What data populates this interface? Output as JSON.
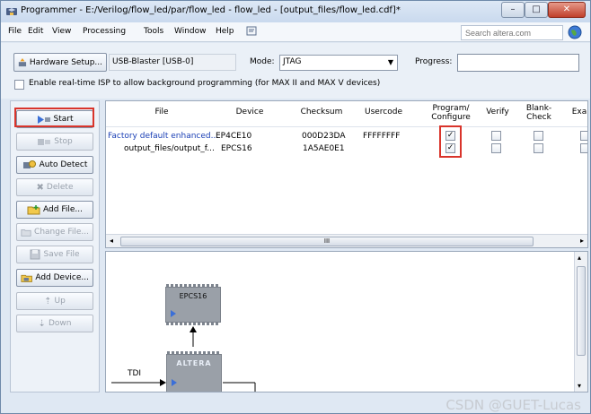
{
  "window": {
    "title": "Programmer - E:/Verilog/flow_led/par/flow_led - flow_led - [output_files/flow_led.cdf]*",
    "controls": {
      "minimize": "–",
      "maximize": "□",
      "close": "✕"
    }
  },
  "menu": {
    "items": [
      "File",
      "Edit",
      "View",
      "Processing",
      "Tools",
      "Window",
      "Help"
    ],
    "search_placeholder": "Search altera.com"
  },
  "toolbar": {
    "hardware_setup_label": "Hardware Setup...",
    "hardware_value": "USB-Blaster [USB-0]",
    "mode_label": "Mode:",
    "mode_value": "JTAG",
    "progress_label": "Progress:",
    "progress": 0,
    "isp_label": "Enable real-time ISP to allow background programming (for MAX II and MAX V devices)",
    "isp_checked": false
  },
  "side_buttons": {
    "start": "Start",
    "stop": "Stop",
    "auto_detect": "Auto Detect",
    "delete": "Delete",
    "add_file": "Add File...",
    "change_file": "Change File...",
    "save_file": "Save File",
    "add_device": "Add Device...",
    "up": "Up",
    "down": "Down"
  },
  "table": {
    "headers": [
      "File",
      "Device",
      "Checksum",
      "Usercode",
      "Program/ Configure",
      "Verify",
      "Blank- Check",
      "Exa"
    ],
    "rows": [
      {
        "file": "Factory default enhanced...",
        "device": "EP4CE10",
        "checksum": "000D23DA",
        "usercode": "FFFFFFFF",
        "program": true,
        "verify": false,
        "blank_check": false
      },
      {
        "file": "output_files/output_f...",
        "device": "EPCS16",
        "checksum": "1A5AE0E1",
        "usercode": "",
        "program": true,
        "verify": false,
        "blank_check": false
      }
    ],
    "scroll_grip": "III"
  },
  "chain": {
    "chip1_label": "EPCS16",
    "chip2_label": "ALTERA",
    "tdi_label": "TDI"
  },
  "watermark": "CSDN @GUET-Lucas",
  "colors": {
    "highlight": "#d9342b",
    "link_blue": "#1a3fb5"
  }
}
